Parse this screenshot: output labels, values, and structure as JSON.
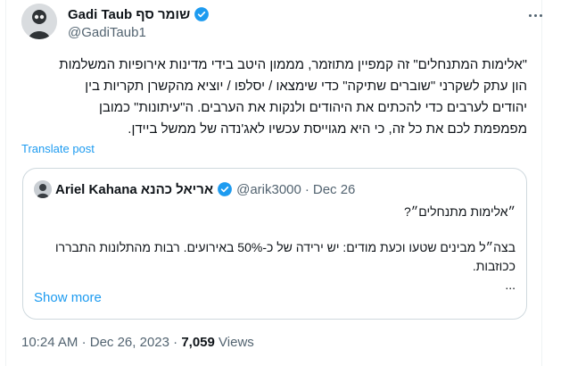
{
  "author": {
    "name": "Gadi Taub שומר סף",
    "handle": "@GadiTaub1",
    "verified_color": "#1d9bf0"
  },
  "post": {
    "lines": [
      "\"אלימות המתנחלים\" זה קמפיין מתוזמר, מממון היטב בידי מדינות אירופיות המשלמות",
      "הון עתק לשקרני \"שוברים שתיקה\" כדי שימצאו / יסלפו / יוציא מהקשרן תקריות בין",
      "יהודים לערבים כדי להכתים את היהודים ולנקות את הערבים. ה\"עיתונות\" כמובן",
      "מפמפמת לכם את כל זה, כי היא מגוייסת עכשיו לאג'נדה של ממשל ביידן."
    ],
    "translate_label": "Translate post"
  },
  "quote": {
    "name": "Ariel Kahana אריאל כהנא",
    "handle": "@arik3000",
    "separator": "·",
    "date": "Dec 26",
    "line1": "״אלימות מתנחלים״?",
    "line2": "בצה״ל מבינים שטעו וכעת מודים: יש ירידה של כ-50% באירועים. רבות מהתלונות התבררו",
    "line3": "ככוזבות.",
    "line4": "...",
    "show_more": "Show more"
  },
  "meta": {
    "time": "10:24 AM",
    "separator1": "·",
    "date": "Dec 26, 2023",
    "separator2": "·",
    "views_count": "7,059",
    "views_label": "Views"
  }
}
